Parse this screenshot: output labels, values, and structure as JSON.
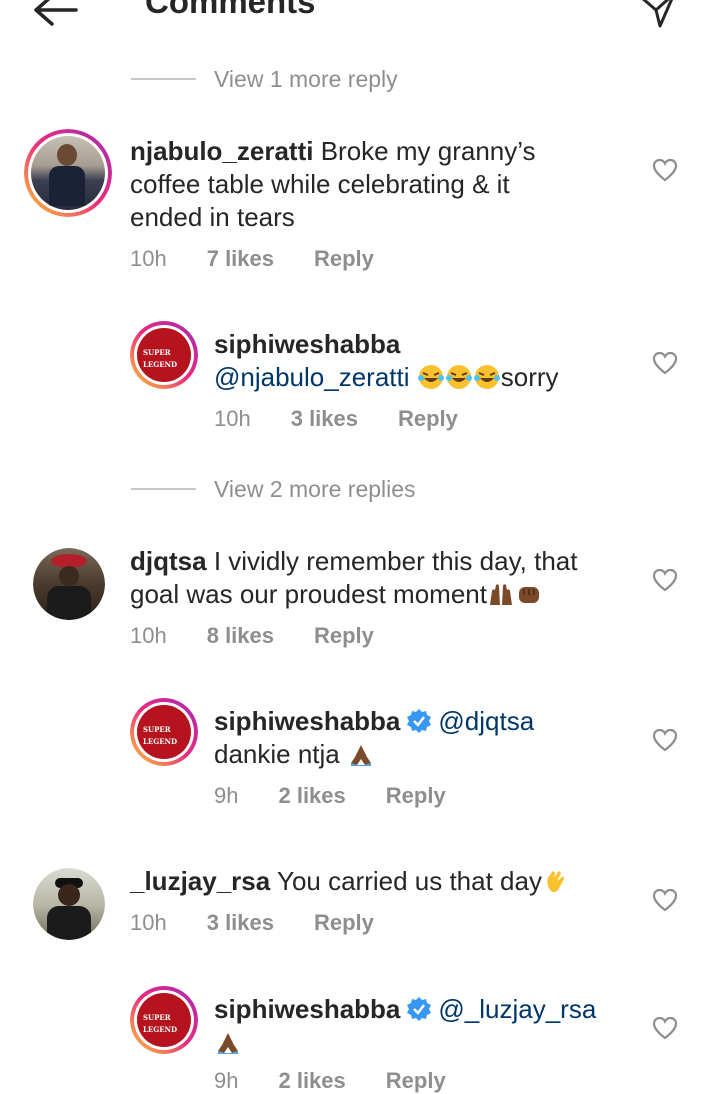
{
  "header": {
    "title": "Comments"
  },
  "threads": [
    {
      "view_more": "View 1 more reply"
    },
    {
      "view_more": "View 2 more replies"
    }
  ],
  "comments": [
    {
      "user": "njabulo_zeratti",
      "text": "Broke my granny’s",
      "text2": "coffee table while celebrating & it",
      "text3": "ended in tears",
      "time": "10h",
      "likes": "7 likes",
      "reply": "Reply"
    },
    {
      "user": "siphiweshabba",
      "mention": "@njabulo_zeratti",
      "text": "sorry",
      "time": "10h",
      "likes": "3 likes",
      "reply": "Reply"
    },
    {
      "user": "djqtsa",
      "text": "I vividly remember this day, that",
      "text2": "goal was our proudest moment",
      "time": "10h",
      "likes": "8 likes",
      "reply": "Reply"
    },
    {
      "user": "siphiweshabba",
      "mention": "@djqtsa",
      "text": "dankie ntja",
      "time": "9h",
      "likes": "2 likes",
      "reply": "Reply"
    },
    {
      "user": "_luzjay_rsa",
      "text": "You carried us that day",
      "time": "10h",
      "likes": "3 likes",
      "reply": "Reply"
    },
    {
      "user": "siphiweshabba",
      "mention": "@_luzjay_rsa",
      "time": "9h",
      "likes": "2 likes",
      "reply": "Reply"
    }
  ],
  "icons": [
    "back-arrow-icon",
    "send-icon",
    "heart-icon",
    "verified-badge-icon"
  ],
  "colors": {
    "mention": "#00376b",
    "muted": "#8e8e8e",
    "verified": "#3897f0"
  }
}
